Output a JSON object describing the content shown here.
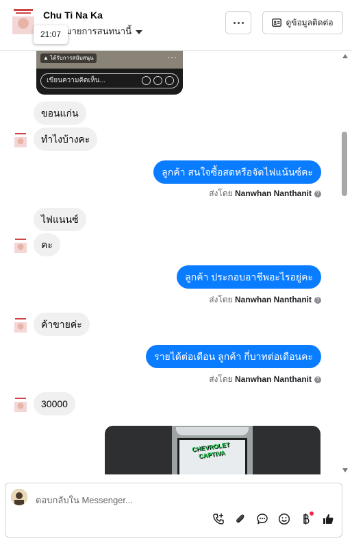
{
  "header": {
    "name": "Chu Ti Na Ka",
    "subtitle": "มายการสนทนานี้",
    "tooltip_time": "21:07",
    "more_label": "...",
    "contact_button": "ดูข้อมูลติดต่อ"
  },
  "video_card": {
    "sponsored_label": "ได้รับการสนับสนุน",
    "comment_placeholder": "เขียนความคิดเห็น..."
  },
  "messages": [
    {
      "direction": "in",
      "text": "ขอนแก่น"
    },
    {
      "direction": "in",
      "text": "ทำไงบ้างคะ"
    },
    {
      "direction": "out",
      "text": "ลูกค้า  สนใจซื้อสดหรือจัดไฟแน้นซ์คะ",
      "sent_prefix": "ส่งโดย",
      "sent_by": "Nanwhan Nanthanit"
    },
    {
      "direction": "in",
      "text": "ไฟแนนซ์"
    },
    {
      "direction": "in",
      "text": "คะ"
    },
    {
      "direction": "out",
      "text": "ลูกค้า ประกอบอาชีพอะไรอยู่คะ",
      "sent_prefix": "ส่งโดย",
      "sent_by": "Nanwhan Nanthanit"
    },
    {
      "direction": "in",
      "text": "ค้าขายค่ะ"
    },
    {
      "direction": "out",
      "text": "รายได้ต่อเดือน ลูกค้า กี่บาทต่อเดือนคะ",
      "sent_prefix": "ส่งโดย",
      "sent_by": "Nanwhan Nanthanit"
    },
    {
      "direction": "in",
      "text": "30000"
    }
  ],
  "image_logo_text": "CHEVROLET CAPTIVA",
  "composer": {
    "placeholder": "ตอบกลับใน Messenger..."
  },
  "icons": {
    "call": "phone-plus-icon",
    "attach": "paperclip-icon",
    "saved_reply": "chat-bubble-icon",
    "emoji": "smiley-icon",
    "payment": "baht-icon",
    "like": "thumbs-up-icon"
  },
  "colors": {
    "outgoing_bubble": "#0a7cff",
    "incoming_bubble": "#f0f0f0",
    "notification_dot": "#f02849"
  }
}
